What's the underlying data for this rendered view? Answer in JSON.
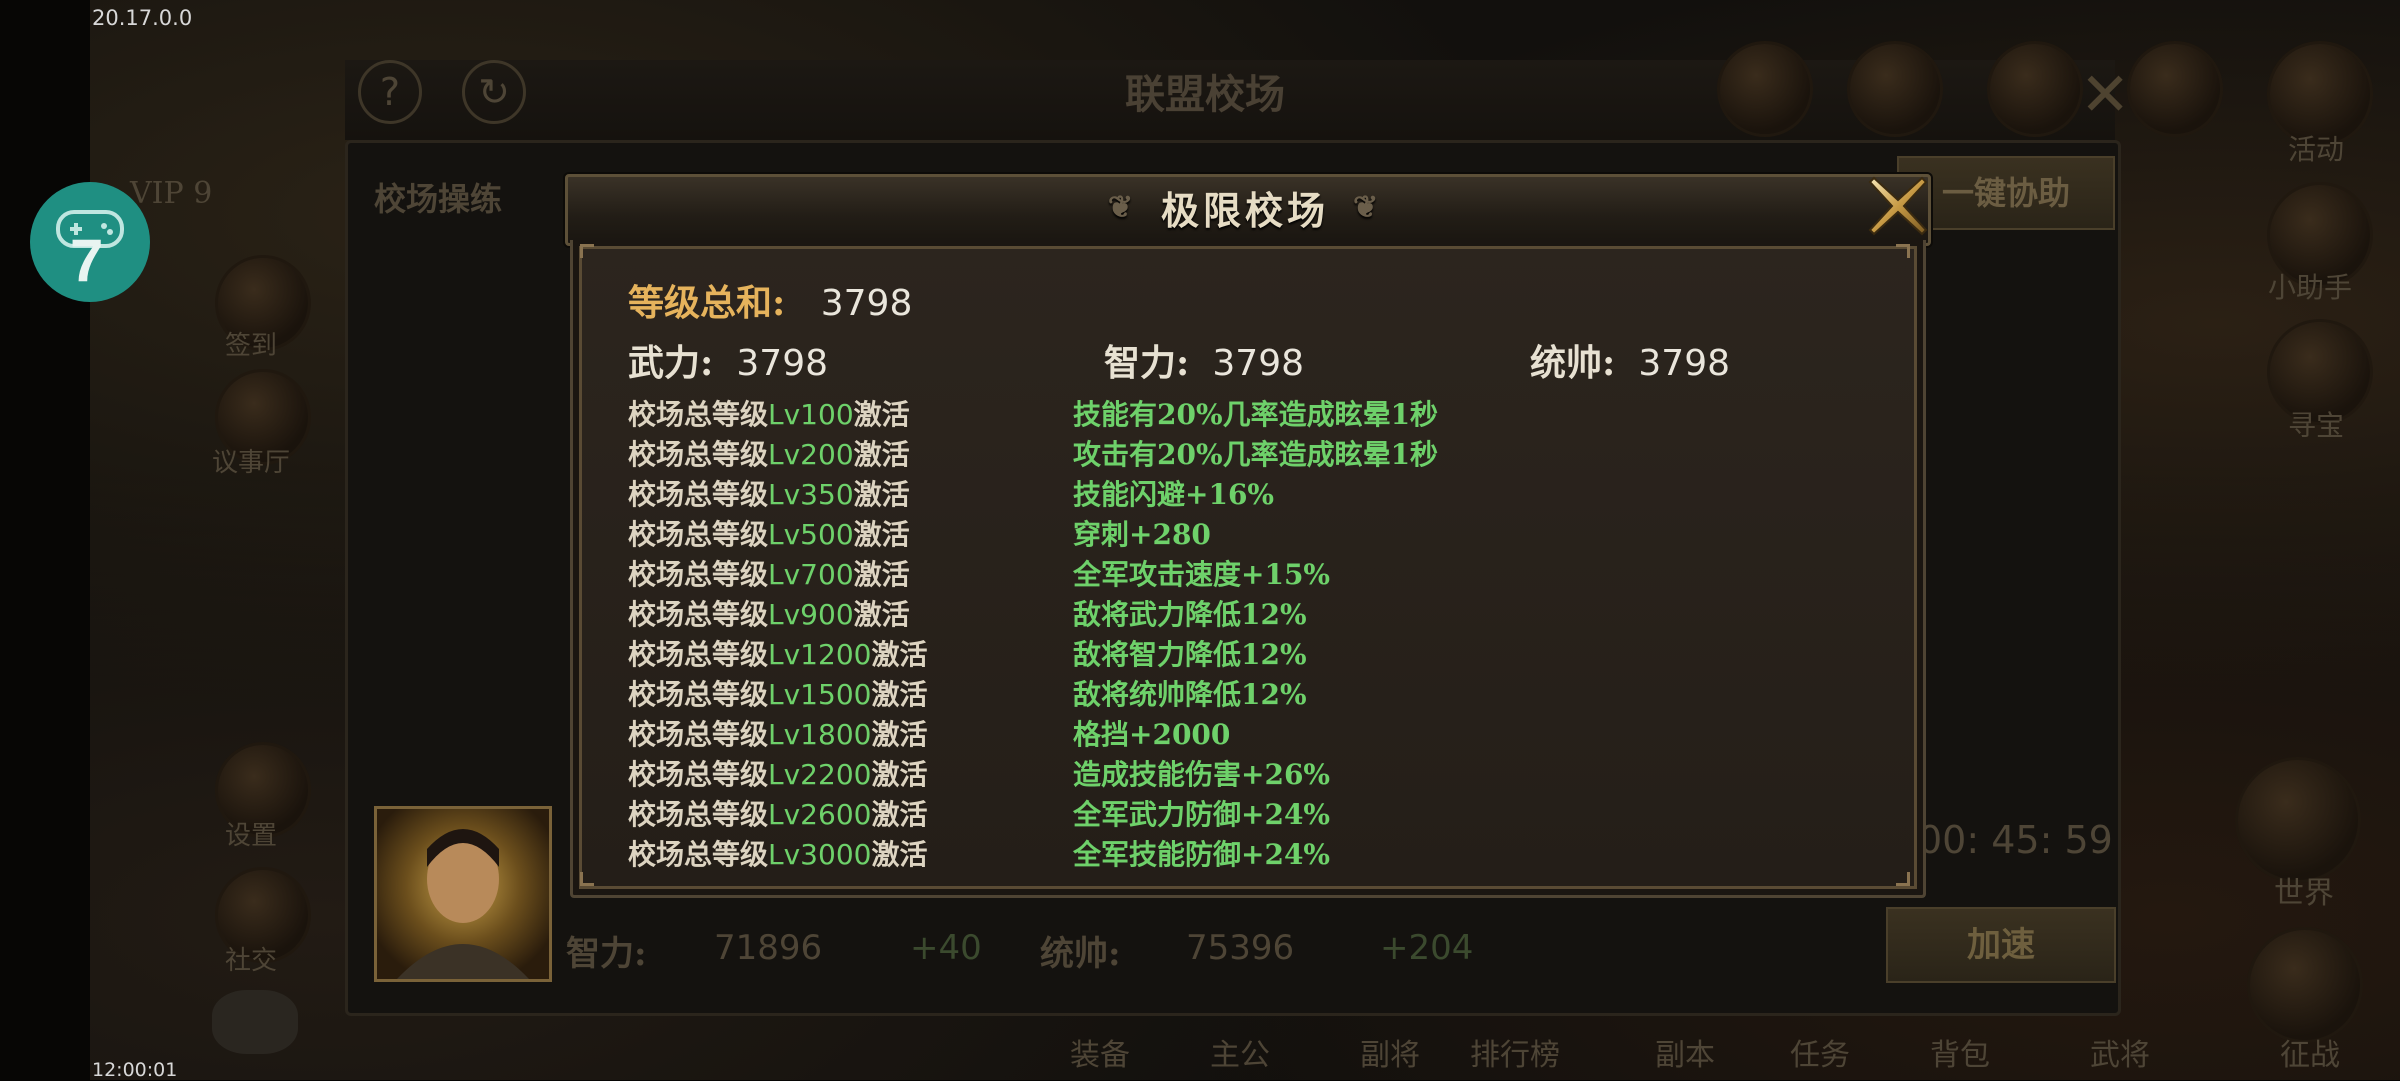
{
  "status": {
    "version": "20.17.0.0",
    "clock": "12:00:01"
  },
  "badge": {
    "number": "7"
  },
  "background": {
    "window_title": "联盟校场",
    "tab_label": "校场操练",
    "assist_button": "一键协助",
    "timer": "00: 45: 59",
    "speedup_button": "加速",
    "vip": "VIP 9",
    "left_menu": [
      "签到",
      "议事厅",
      "设置",
      "社交"
    ],
    "right_menu": [
      "活动",
      "小助手",
      "寻宝",
      "世界",
      "征战"
    ],
    "bottom_nav": [
      "装备",
      "主公",
      "副将",
      "排行榜",
      "副本",
      "任务",
      "背包",
      "武将"
    ],
    "hero_stats": {
      "zhili_label": "智力:",
      "zhili_value": "71896",
      "zhili_bonus": "+40",
      "tongshuai_label": "统帅:",
      "tongshuai_value": "75396",
      "tongshuai_bonus": "+204"
    }
  },
  "modal": {
    "title": "极限校场",
    "sum_label": "等级总和:",
    "sum_value": "3798",
    "stats": [
      {
        "label": "武力:",
        "value": "3798"
      },
      {
        "label": "智力:",
        "value": "3798"
      },
      {
        "label": "统帅:",
        "value": "3798"
      }
    ],
    "condition_prefix": "校场总等级",
    "condition_suffix": "激活",
    "abilities": [
      {
        "level": "Lv100",
        "effect": "技能有20%几率造成眩晕1秒"
      },
      {
        "level": "Lv200",
        "effect": "攻击有20%几率造成眩晕1秒"
      },
      {
        "level": "Lv350",
        "effect": "技能闪避+16%"
      },
      {
        "level": "Lv500",
        "effect": "穿刺+280"
      },
      {
        "level": "Lv700",
        "effect": "全军攻击速度+15%"
      },
      {
        "level": "Lv900",
        "effect": "敌将武力降低12%"
      },
      {
        "level": "Lv1200",
        "effect": "敌将智力降低12%"
      },
      {
        "level": "Lv1500",
        "effect": "敌将统帅降低12%"
      },
      {
        "level": "Lv1800",
        "effect": "格挡+2000"
      },
      {
        "level": "Lv2200",
        "effect": "造成技能伤害+26%"
      },
      {
        "level": "Lv2600",
        "effect": "全军武力防御+24%"
      },
      {
        "level": "Lv3000",
        "effect": "全军技能防御+24%"
      }
    ]
  },
  "colors": {
    "title_gold": "#e6b35c",
    "effect_green": "#6ed16a",
    "badge_teal": "#1f8f82"
  }
}
